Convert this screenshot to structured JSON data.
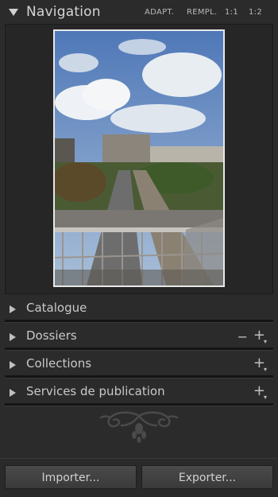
{
  "navigation": {
    "title": "Navigation",
    "zoom_options": [
      "ADAPT.",
      "REMPL.",
      "1:1",
      "1:2"
    ]
  },
  "panels": [
    {
      "label": "Catalogue"
    },
    {
      "label": "Dossiers"
    },
    {
      "label": "Collections"
    },
    {
      "label": "Services de publication"
    }
  ],
  "buttons": {
    "import_label": "Importer...",
    "export_label": "Exporter..."
  }
}
